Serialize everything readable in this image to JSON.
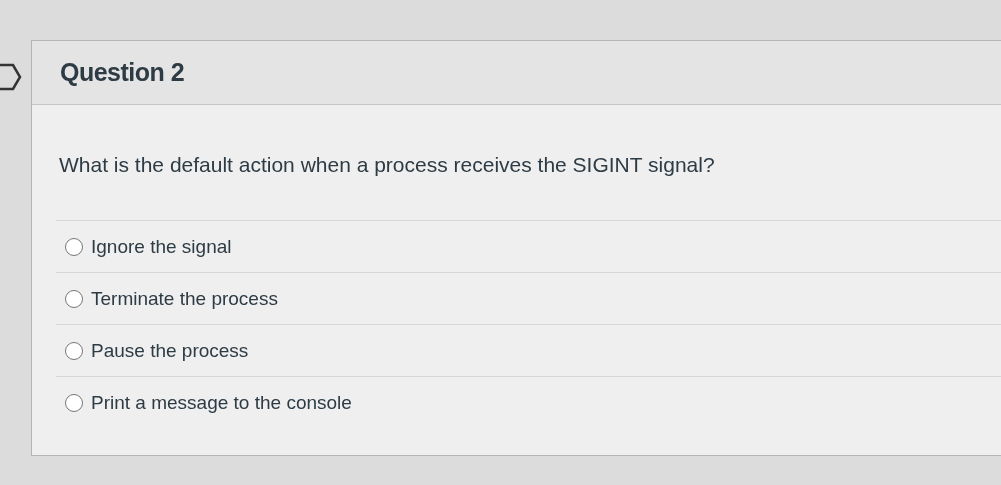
{
  "question": {
    "title": "Question 2",
    "text": "What is the default action when a process receives the SIGINT signal?",
    "options": [
      {
        "label": "Ignore the signal",
        "selected": false
      },
      {
        "label": "Terminate the process",
        "selected": false
      },
      {
        "label": "Pause the process",
        "selected": false
      },
      {
        "label": "Print a message to the console",
        "selected": false
      }
    ]
  }
}
